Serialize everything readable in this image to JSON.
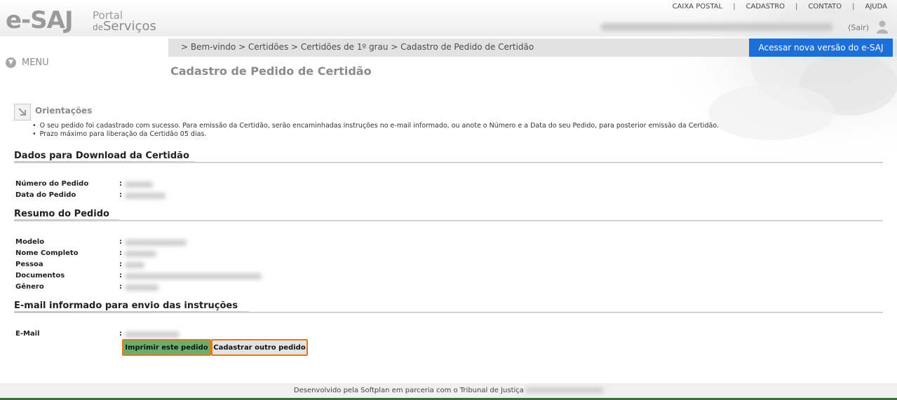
{
  "header": {
    "logo_main": "e-SAJ",
    "logo_portal": "Portal",
    "logo_de": "de",
    "logo_servicos": "Serviços",
    "top_links": [
      "CAIXA POSTAL",
      "CADASTRO",
      "CONTATO",
      "AJUDA"
    ],
    "sair_label": "(Sair)"
  },
  "breadcrumb": {
    "text": "> Bem-vindo > Certidões > Certidões de 1º grau > Cadastro de Pedido de Certidão"
  },
  "new_version_label": "Acessar nova versão do e-SAJ",
  "menu_label": "MENU",
  "page_title": "Cadastro de Pedido de Certidão",
  "orientations": {
    "title": "Orientações",
    "items": [
      "O seu pedido foi cadastrado com sucesso. Para emissão da Certidão, serão encaminhadas instruções no e-mail informado, ou anote o Número e a Data do seu Pedido, para posterior emissão da Certidão.",
      "Prazo máximo para liberação da Certidão 05 dias."
    ]
  },
  "download_section": {
    "title": "Dados para Download da Certidão",
    "fields": [
      {
        "label": "Número do Pedido"
      },
      {
        "label": "Data do Pedido"
      }
    ]
  },
  "summary_section": {
    "title": "Resumo do Pedido",
    "fields": [
      {
        "label": "Modelo"
      },
      {
        "label": "Nome Completo"
      },
      {
        "label": "Pessoa"
      },
      {
        "label": "Documentos"
      },
      {
        "label": "Gênero"
      }
    ]
  },
  "email_section": {
    "title": "E-mail informado para envio das instruções",
    "fields": [
      {
        "label": "E-Mail"
      }
    ]
  },
  "buttons": {
    "print": "Imprimir este pedido",
    "new": "Cadastrar outro pedido"
  },
  "footer": {
    "text": "Desenvolvido pela Softplan em parceria com o Tribunal de Justiça"
  },
  "colors": {
    "accent_blue": "#1b6fd6",
    "print_button": "#6bae6b",
    "button_border": "#e07a1c"
  }
}
